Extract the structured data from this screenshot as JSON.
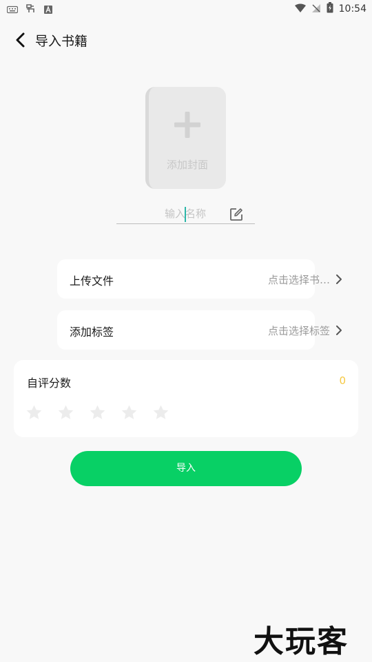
{
  "status_bar": {
    "time": "10:54",
    "left_icons": [
      "keyboard-icon",
      "bug-icon",
      "a-badge-icon"
    ],
    "right_icons": [
      "wifi-icon",
      "no-signal-icon",
      "battery-charging-icon"
    ]
  },
  "header": {
    "title": "导入书籍",
    "back_icon": "chevron-left-icon"
  },
  "cover": {
    "label": "添加封面",
    "icon": "plus-icon"
  },
  "name_input": {
    "placeholder": "输入名称",
    "value": "",
    "icon": "edit-icon"
  },
  "rows": [
    {
      "label": "上传文件",
      "value": "点击选择书…",
      "icon": "chevron-right-icon"
    },
    {
      "label": "添加标签",
      "value": "点击选择标签",
      "icon": "chevron-right-icon"
    }
  ],
  "rating": {
    "title": "自评分数",
    "score": "0",
    "stars_total": 5,
    "stars_filled": 0,
    "score_color": "#f5c842"
  },
  "import_button": {
    "label": "导入",
    "color": "#08d065"
  },
  "watermark": {
    "text": "大玩客"
  }
}
